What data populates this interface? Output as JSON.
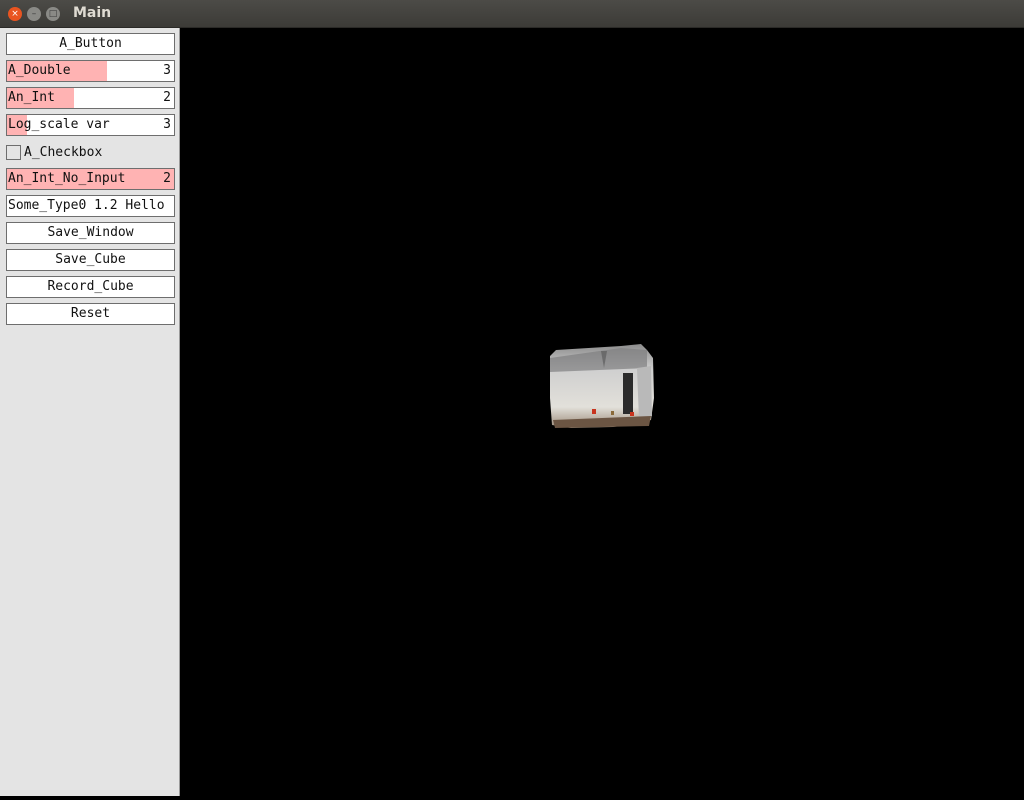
{
  "window": {
    "title": "Main",
    "close_glyph": "×",
    "min_glyph": "–",
    "max_glyph": "□"
  },
  "panel": {
    "a_button": "A_Button",
    "a_double": {
      "label": "A_Double",
      "value": "3",
      "fraction": 0.6
    },
    "an_int": {
      "label": "An_Int",
      "value": "2",
      "fraction": 0.4
    },
    "log_scale": {
      "label": "Log_scale var",
      "value": "3",
      "fraction": 0.12
    },
    "a_checkbox": {
      "label": "A_Checkbox",
      "checked": false
    },
    "an_int_no_input": {
      "label": "An_Int_No_Input",
      "value": "2",
      "fraction": 1.0
    },
    "some_type": "Some_Type0 1.2 Hello",
    "save_window": "Save_Window",
    "save_cube": "Save_Cube",
    "record_cube": "Record_Cube",
    "reset": "Reset"
  },
  "colors": {
    "slider_fill": "#ffb3b3",
    "panel_bg": "#e4e4e4",
    "view_bg": "#000000",
    "close_button": "#e95420"
  }
}
